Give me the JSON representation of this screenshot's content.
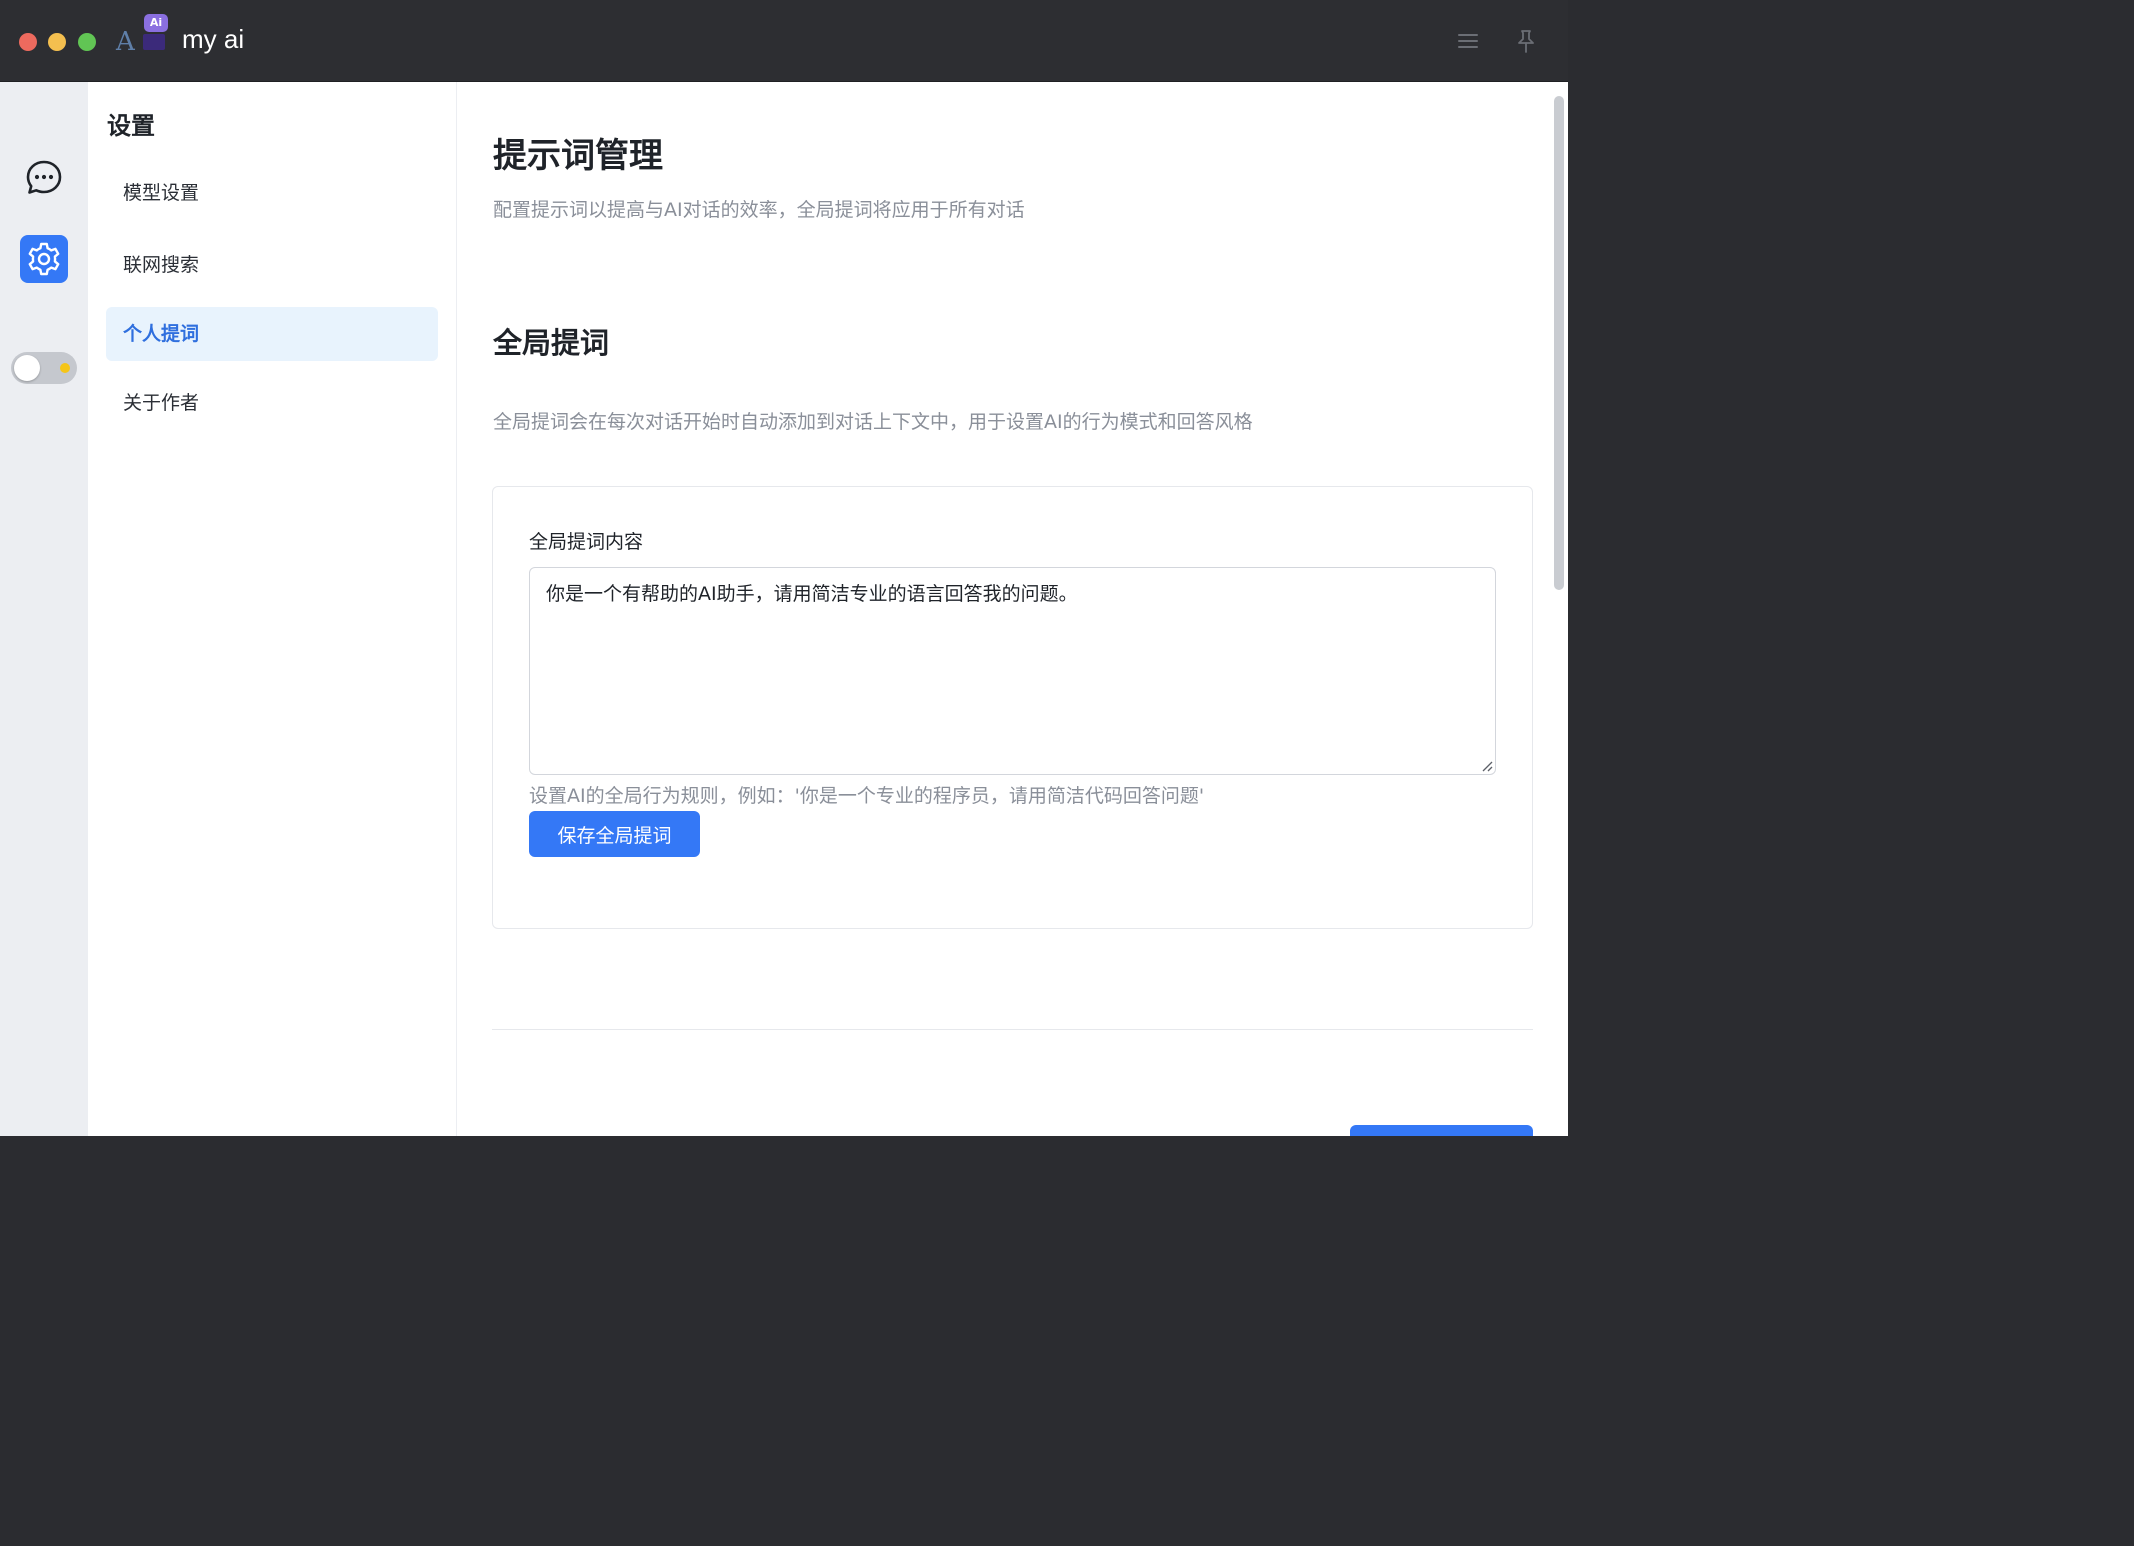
{
  "window": {
    "app_title": "my ai",
    "logo_badge": "Ai",
    "logo_letter": "A"
  },
  "rail": {
    "items": [
      {
        "id": "chat",
        "icon": "chat-bubble-icon",
        "active": false
      },
      {
        "id": "settings",
        "icon": "gear-icon",
        "active": true
      }
    ],
    "theme_toggle": {
      "state": "light",
      "icon": "sun-icon"
    }
  },
  "settings_nav": {
    "title": "设置",
    "items": [
      {
        "label": "模型设置",
        "active": false
      },
      {
        "label": "联网搜索",
        "active": false
      },
      {
        "label": "个人提词",
        "active": true
      },
      {
        "label": "关于作者",
        "active": false
      }
    ]
  },
  "main": {
    "title": "提示词管理",
    "description": "配置提示词以提高与AI对话的效率，全局提词将应用于所有对话",
    "section": {
      "title": "全局提词",
      "description": "全局提词会在每次对话开始时自动添加到对话上下文中，用于设置AI的行为模式和回答风格",
      "field_label": "全局提词内容",
      "field_value": "你是一个有帮助的AI助手，请用简洁专业的语言回答我的问题。",
      "field_help": "设置AI的全局行为规则，例如：'你是一个专业的程序员，请用简洁代码回答问题'",
      "save_label": "保存全局提词"
    }
  },
  "colors": {
    "accent": "#3478f6",
    "titlebar": "#2d2e32",
    "rail_bg": "#eceef2",
    "nav_active_bg": "#e8f3fd",
    "nav_active_text": "#2f6fde",
    "muted_text": "#8a8f99"
  }
}
